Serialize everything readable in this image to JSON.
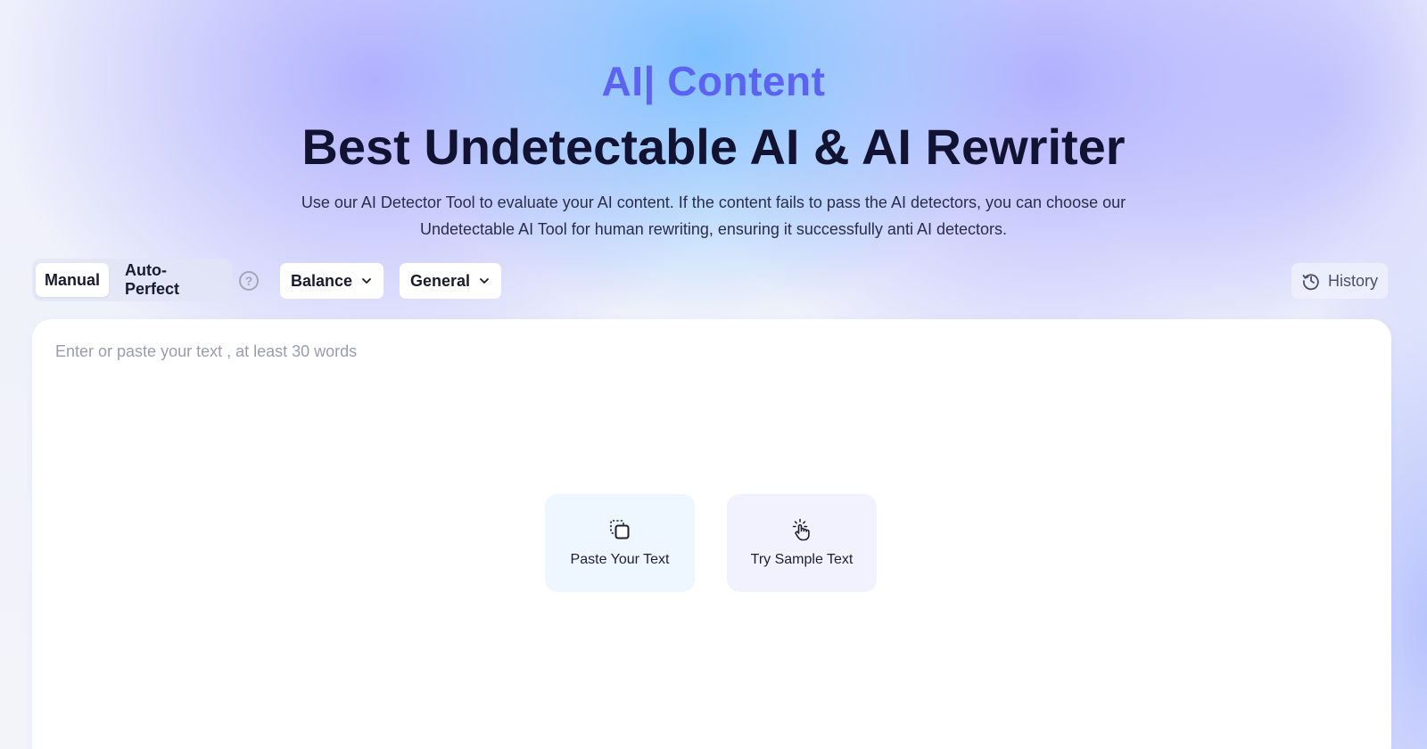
{
  "hero": {
    "brand": "AI| Content",
    "title": "Best Undetectable AI & AI Rewriter",
    "subtitle": "Use our AI Detector Tool to evaluate your AI content. If the content fails to pass the AI detectors, you can choose our Undetectable AI Tool for human rewriting, ensuring it successfully anti AI detectors."
  },
  "toolbar": {
    "modes": [
      {
        "label": "Manual",
        "active": true
      },
      {
        "label": "Auto-Perfect",
        "active": false
      }
    ],
    "help_glyph": "?",
    "rewrite_mode": {
      "selected": "Balance"
    },
    "purpose": {
      "selected": "General"
    },
    "history_label": "History"
  },
  "editor": {
    "placeholder": "Enter or paste your text , at least 30 words",
    "value": "",
    "actions": {
      "paste_label": "Paste Your Text",
      "sample_label": "Try Sample Text"
    }
  },
  "icons": {
    "help": "question-circle-icon",
    "chevron": "chevron-down-icon",
    "history": "history-clock-icon",
    "paste": "paste-clipboard-icon",
    "sample": "pointer-hand-icon"
  },
  "colors": {
    "brand": "#5b63f0",
    "title": "#121232",
    "paste_card_bg": "#eef6ff",
    "sample_card_bg": "#f1f2fd"
  }
}
